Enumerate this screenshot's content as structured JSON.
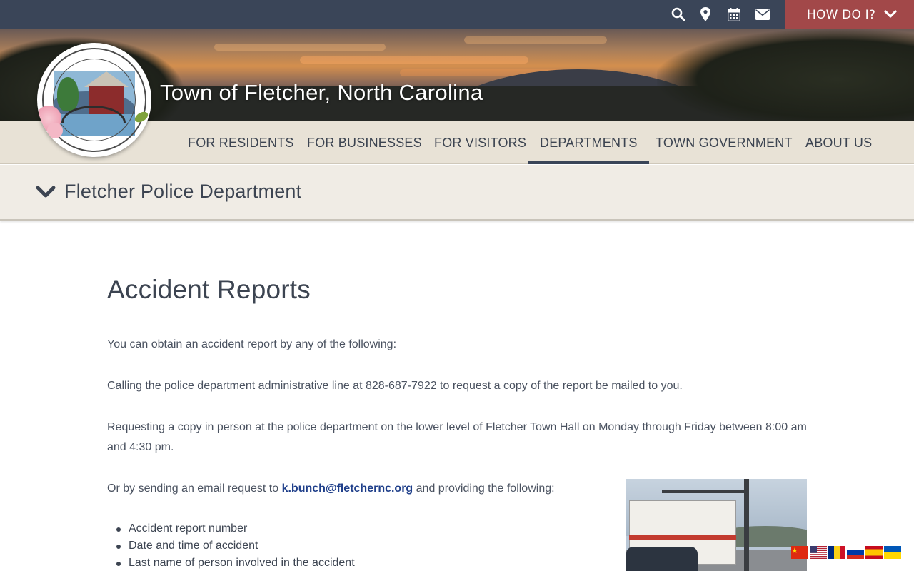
{
  "topbar": {
    "icons": [
      "search-icon",
      "map-marker-icon",
      "calendar-icon",
      "envelope-icon"
    ],
    "how_do_i_label": "HOW DO I?",
    "colors": {
      "bar": "#3a4558",
      "how_do_i": "#a24849"
    }
  },
  "header": {
    "site_title": "Town of Fletcher, North Carolina",
    "logo_alt": "Town of Fletcher, North Carolina seal"
  },
  "nav": {
    "items": [
      {
        "label": "FOR RESIDENTS"
      },
      {
        "label": "FOR BUSINESSES"
      },
      {
        "label": "FOR VISITORS"
      },
      {
        "label": "DEPARTMENTS",
        "active": true
      },
      {
        "label": "TOWN GOVERNMENT"
      },
      {
        "label": "ABOUT US"
      }
    ]
  },
  "department": {
    "title": "Fletcher Police Department"
  },
  "page": {
    "title": "Accident Reports",
    "intro": "You can obtain an accident report by any of the following:",
    "option_call": "Calling the police department administrative line at 828-687-7922 to request a copy of the report be mailed to you.",
    "option_in_person": "Requesting a copy in person at the police department on the lower level of Fletcher Town Hall on Monday through Friday between 8:00 am and 4:30 pm.",
    "option_email_prefix": "Or by sending an email request to ",
    "email": "k.bunch@fletchernc.org",
    "option_email_suffix": " and providing the following:",
    "requirements": [
      "Accident report number",
      "Date and time of accident",
      "Last name of person involved in the accident"
    ]
  },
  "languages": [
    "chinese-flag-icon",
    "us-flag-icon",
    "romanian-flag-icon",
    "russian-flag-icon",
    "spanish-flag-icon",
    "ukrainian-flag-icon"
  ]
}
